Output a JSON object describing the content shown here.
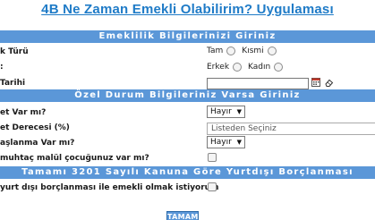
{
  "page": {
    "title": "4B Ne Zaman Emekli Olabilirim? Uygulaması"
  },
  "sections": {
    "emeklilik": "Emeklilik Bilgilerinizi Giriniz",
    "ozel": "Özel Durum Bilgileriniz Varsa Giriniz",
    "yurtdisi": "Tamamı 3201 Sayılı Kanuna Göre Yurtdışı Borçlanması"
  },
  "fields": {
    "calisma_turu": {
      "label": "k Türü",
      "option1": "Tam",
      "option2": "Kısmi"
    },
    "cinsiyet": {
      "label": ":",
      "option1": "Erkek",
      "option2": "Kadın"
    },
    "dogum_tarihi": {
      "label": "Tarihi",
      "value": ""
    },
    "engel": {
      "label": "et Var mı?",
      "value": "Hayır"
    },
    "engel_derecesi": {
      "label": "et Derecesi (%)",
      "placeholder": "Listeden Seçiniz"
    },
    "baslanma": {
      "label": "aşlanma Var mı?",
      "value": "Hayır"
    },
    "muhtac": {
      "label": "muhtaç malül çocuğunuz var mı?",
      "checked": false
    },
    "yurtdisi": {
      "label": "yurt dışı borçlanması ile emekli olmak istiyorum",
      "checked": false
    }
  },
  "buttons": {
    "submit": "TAMAM"
  },
  "colors": {
    "title": "#1f7bc7",
    "section_bar": "#5b97d8",
    "button": "#5b97d8"
  }
}
